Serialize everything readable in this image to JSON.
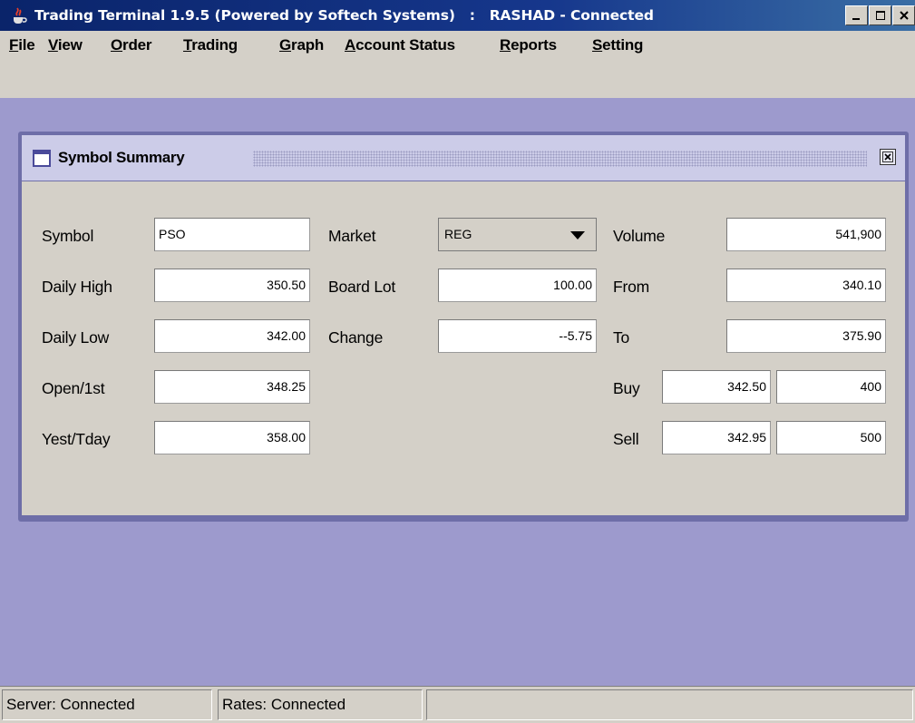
{
  "window": {
    "title": "Trading Terminal 1.9.5 (Powered by Softech Systems)   :   RASHAD - Connected"
  },
  "menu": [
    {
      "label_first": "F",
      "label_rest": "ile"
    },
    {
      "label_first": "V",
      "label_rest": "iew"
    },
    {
      "label_first": "O",
      "label_rest": "rder"
    },
    {
      "label_first": "T",
      "label_rest": "rading"
    },
    {
      "label_first": "G",
      "label_rest": "raph"
    },
    {
      "label_first": "A",
      "label_rest": "ccount Status"
    },
    {
      "label_first": "R",
      "label_rest": "eports"
    },
    {
      "label_first": "S",
      "label_rest": "etting"
    }
  ],
  "summary": {
    "title": "Symbol Summary",
    "symbol_label": "Symbol",
    "symbol_value": "PSO",
    "market_label": "Market",
    "market_value": "REG",
    "volume_label": "Volume",
    "volume_value": "541,900",
    "daily_high_label": "Daily High",
    "daily_high_value": "350.50",
    "board_lot_label": "Board Lot",
    "board_lot_value": "100.00",
    "from_label": "From",
    "from_value": "340.10",
    "daily_low_label": "Daily Low",
    "daily_low_value": "342.00",
    "change_label": "Change",
    "change_value": "--5.75",
    "to_label": "To",
    "to_value": "375.90",
    "open_label": "Open/1st",
    "open_value": "348.25",
    "buy_label": "Buy",
    "buy_price": "342.50",
    "buy_qty": "400",
    "yest_label": "Yest/Tday",
    "yest_value": "358.00",
    "sell_label": "Sell",
    "sell_price": "342.95",
    "sell_qty": "500"
  },
  "status": {
    "server": "Server: Connected",
    "rates": "Rates: Connected"
  },
  "colors": {
    "desktop": "#9d9acd",
    "title_bar": "#0a246a",
    "frame_border": "#6e6ea8"
  }
}
